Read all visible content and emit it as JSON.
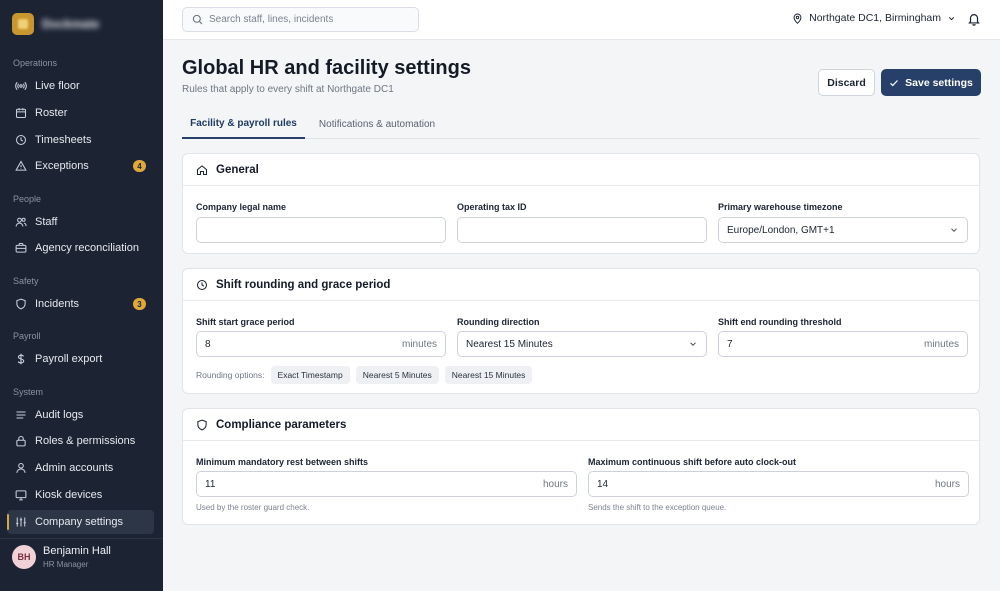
{
  "brand": {
    "name": "Dockmate"
  },
  "nav": {
    "sections": [
      {
        "label": "Operations"
      },
      {
        "label": "People"
      },
      {
        "label": "Safety"
      },
      {
        "label": "Payroll"
      },
      {
        "label": "System"
      }
    ],
    "items": [
      {
        "label": "Live floor",
        "icon": "broadcast-icon"
      },
      {
        "label": "Roster",
        "icon": "calendar-icon"
      },
      {
        "label": "Timesheets",
        "icon": "clock-icon"
      },
      {
        "label": "Exceptions",
        "icon": "warning-icon",
        "badge": "4"
      },
      {
        "label": "Staff",
        "icon": "users-icon"
      },
      {
        "label": "Agency reconciliation",
        "icon": "briefcase-icon"
      },
      {
        "label": "Incidents",
        "icon": "shield-icon",
        "badge": "3"
      },
      {
        "label": "Payroll export",
        "icon": "dollar-icon"
      },
      {
        "label": "Audit logs",
        "icon": "list-icon"
      },
      {
        "label": "Roles & permissions",
        "icon": "lock-icon"
      },
      {
        "label": "Admin accounts",
        "icon": "user-icon"
      },
      {
        "label": "Kiosk devices",
        "icon": "monitor-icon"
      },
      {
        "label": "Company settings",
        "icon": "sliders-icon",
        "active": true
      }
    ]
  },
  "user": {
    "initials": "BH",
    "name": "Benjamin Hall",
    "role": "HR Manager"
  },
  "topbar": {
    "search_placeholder": "Search staff, lines, incidents",
    "site": "Northgate DC1, Birmingham"
  },
  "page": {
    "title": "Global HR and facility settings",
    "subtitle": "Rules that apply to every shift at Northgate DC1",
    "discard_label": "Discard",
    "save_label": "Save settings"
  },
  "tabs": [
    {
      "label": "Facility & payroll rules",
      "active": true
    },
    {
      "label": "Notifications & automation",
      "active": false
    }
  ],
  "general": {
    "title": "General",
    "legal_name_label": "Company legal name",
    "legal_name_value": "",
    "tax_id_label": "Operating tax ID",
    "tax_id_value": "",
    "timezone_label": "Primary warehouse timezone",
    "timezone_value": "Europe/London, GMT+1"
  },
  "rounding": {
    "title": "Shift rounding and grace period",
    "grace_label": "Shift start grace period",
    "grace_value": "8",
    "grace_unit": "minutes",
    "direction_label": "Rounding direction",
    "direction_value": "Nearest 15 Minutes",
    "threshold_label": "Shift end rounding threshold",
    "threshold_value": "7",
    "threshold_unit": "minutes",
    "options_label": "Rounding options:",
    "options": [
      "Exact Timestamp",
      "Nearest 5 Minutes",
      "Nearest 15 Minutes"
    ]
  },
  "compliance": {
    "title": "Compliance parameters",
    "rest_label": "Minimum mandatory rest between shifts",
    "rest_value": "11",
    "rest_unit": "hours",
    "rest_help": "Used by the roster guard check.",
    "max_label": "Maximum continuous shift before auto clock-out",
    "max_value": "14",
    "max_unit": "hours",
    "max_help": "Sends the shift to the exception queue."
  }
}
